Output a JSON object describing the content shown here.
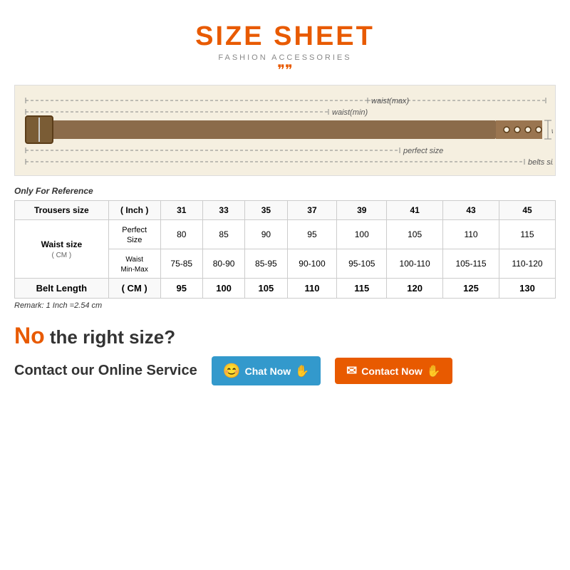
{
  "title": "SIZE SHEET",
  "subtitle": "FASHION ACCESSORIES",
  "chevron": "≫",
  "reference_label": "Only For Reference",
  "table": {
    "header": {
      "col1": "Trousers size",
      "col2": "( Inch )",
      "sizes": [
        "31",
        "33",
        "35",
        "37",
        "39",
        "41",
        "43",
        "45"
      ]
    },
    "waist_row": {
      "label": "Waist size",
      "sublabel": "( CM )",
      "perfect_label": "Perfect Size",
      "waist_label": "Waist Min-Max",
      "perfect": [
        "80",
        "85",
        "90",
        "95",
        "100",
        "105",
        "110",
        "115"
      ],
      "minmax": [
        "75-85",
        "80-90",
        "85-95",
        "90-100",
        "95-105",
        "100-110",
        "105-115",
        "110-120"
      ]
    },
    "belt_row": {
      "label": "Belt Length",
      "unit": "( CM )",
      "values": [
        "95",
        "100",
        "105",
        "110",
        "115",
        "120",
        "125",
        "130"
      ]
    }
  },
  "remark": "Remark: 1 Inch =2.54 cm",
  "no_size_question": "the right size?",
  "no_label": "No",
  "contact_label": "Contact our Online Service",
  "chat_btn": "Chat Now",
  "contact_btn": "Contact Now",
  "belt_measures": {
    "waist_max": "waist(max)",
    "waist_min": "waist(min)",
    "perfect_size": "perfect size",
    "belts_size": "belts size",
    "width": "width"
  }
}
